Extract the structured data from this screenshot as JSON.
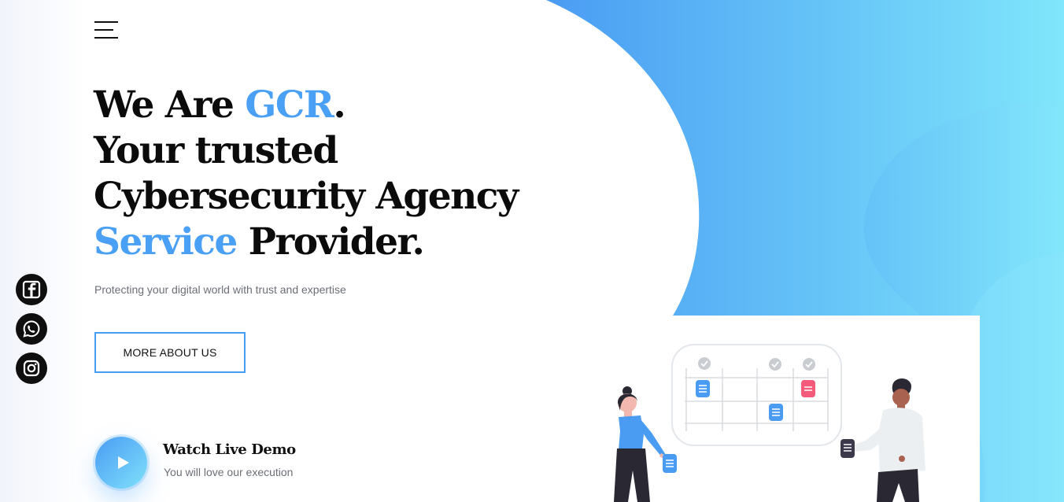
{
  "header": {
    "menu_icon": "hamburger-icon"
  },
  "hero": {
    "line1_prefix": "We Are ",
    "line1_brand": "GCR",
    "line1_suffix": ".",
    "line2": "Your trusted",
    "line3": "Cybersecurity Agency",
    "line4_accent": "Service",
    "line4_rest": " Provider.",
    "tagline": "Protecting your digital world with trust and expertise",
    "cta_label": "MORE ABOUT US"
  },
  "social": [
    {
      "name": "facebook",
      "icon": "facebook-icon"
    },
    {
      "name": "whatsapp",
      "icon": "whatsapp-icon"
    },
    {
      "name": "instagram",
      "icon": "instagram-icon"
    }
  ],
  "demo": {
    "title": "Watch Live Demo",
    "subtitle": "You will love our execution",
    "icon": "play-icon"
  },
  "colors": {
    "accent": "#4aa0f4",
    "gradient_start": "#4a9cf3",
    "gradient_end": "#7fe6fb",
    "text_dark": "#0b0b0b",
    "text_muted": "#6b6f76",
    "calendar_blue": "#4a9cf3",
    "calendar_pink": "#f45a7a"
  }
}
